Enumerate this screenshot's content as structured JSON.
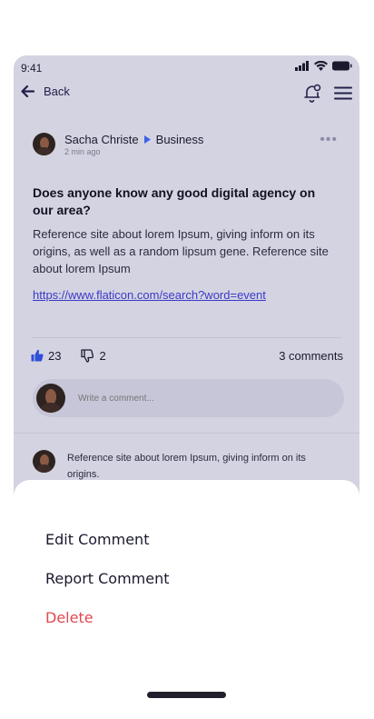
{
  "status_bar": {
    "time": "9:41"
  },
  "nav": {
    "back_label": "Back"
  },
  "post": {
    "author": "Sacha Christe",
    "category": "Business",
    "time_ago": "2 min ago",
    "more": "•••",
    "title": "Does anyone know any good digital agency on our area?",
    "body": "Reference site about lorem Ipsum, giving inform on its origins, as well as a random lipsum gene. Reference site about lorem Ipsum",
    "link": "https://www.flaticon.com/search?word=event",
    "likes": "23",
    "dislikes": "2",
    "comments": "3 comments"
  },
  "comment_input": {
    "placeholder": "Write a comment..."
  },
  "reply": {
    "text": "Reference site about lorem Ipsum, giving inform on its origins."
  },
  "sheet": {
    "edit": "Edit Comment",
    "report": "Report Comment",
    "delete": "Delete"
  },
  "colors": {
    "accent": "#3a3acb",
    "danger": "#e0494f",
    "background": "#d4d3e1"
  }
}
